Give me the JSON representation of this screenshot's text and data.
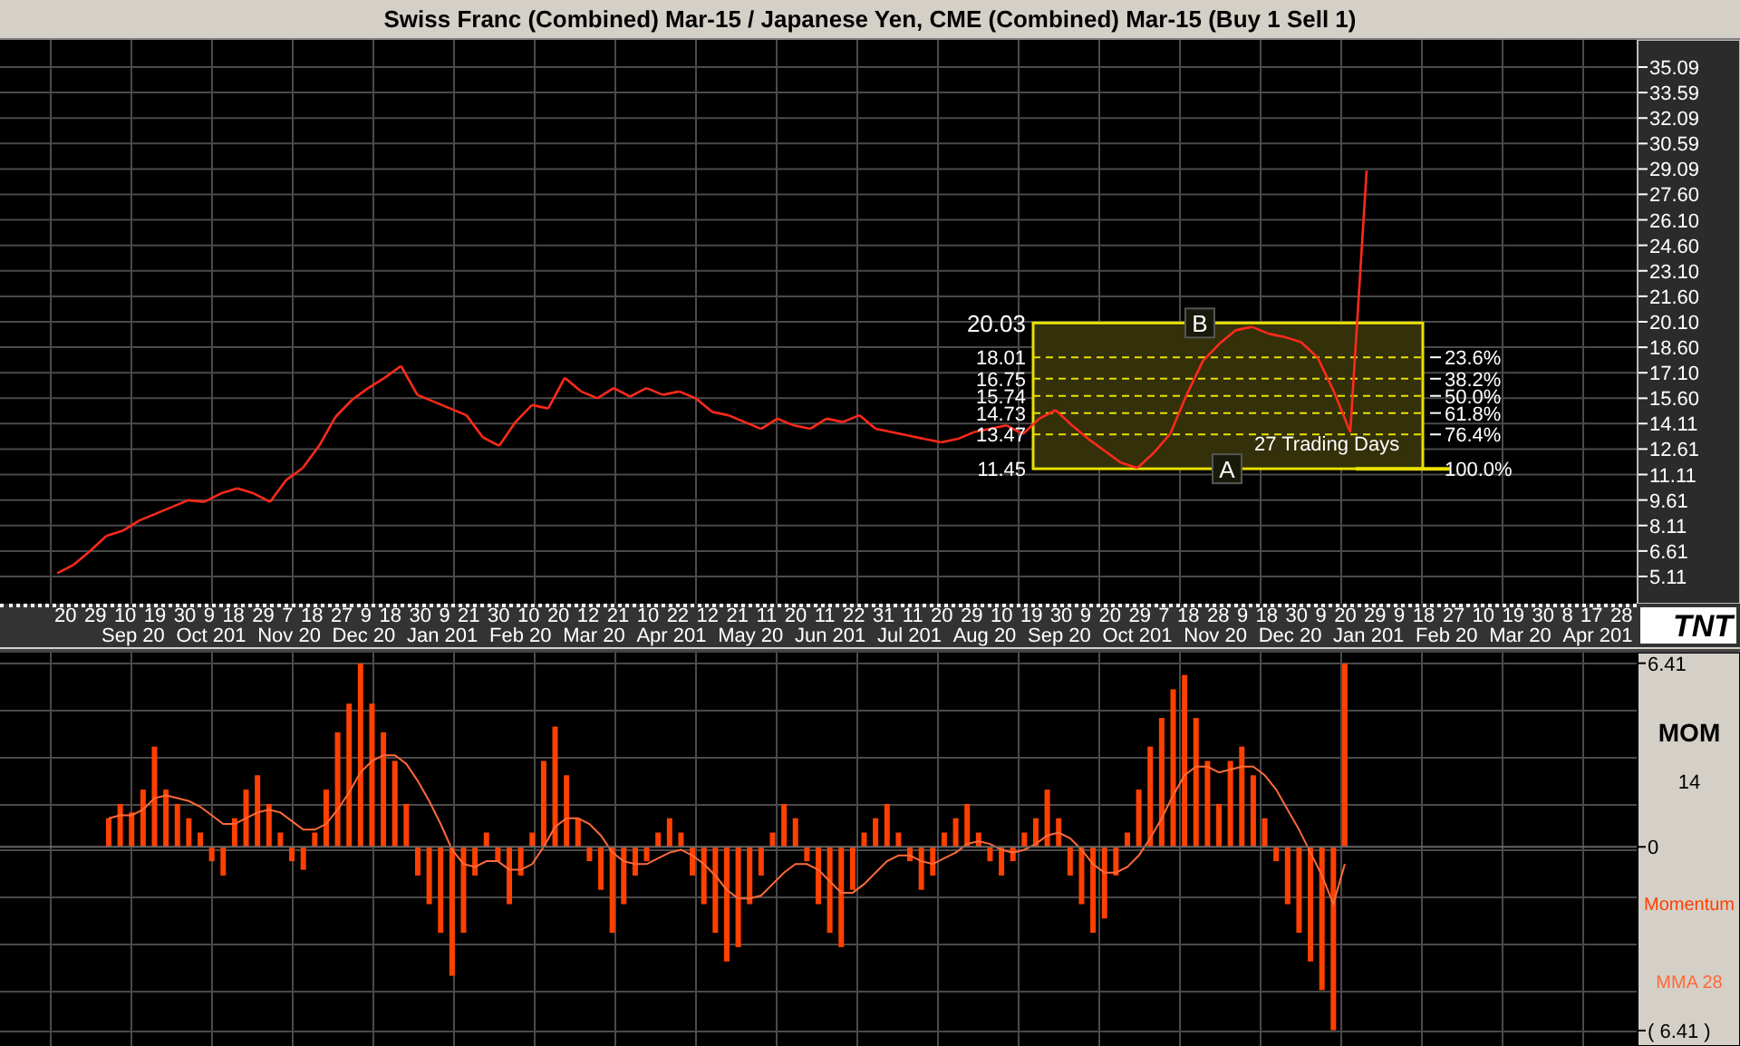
{
  "window": {
    "title": "Swiss Franc (Combined) Mar-15  / Japanese Yen, CME (Combined) Mar-15 (Buy 1 Sell 1)"
  },
  "price_chart": {
    "chart_data": {
      "type": "line",
      "grid": true,
      "ylim": [
        3.51,
        36.69
      ],
      "yticks": [
        {
          "value": 35.09,
          "label": "35.09"
        },
        {
          "value": 33.59,
          "label": "33.59"
        },
        {
          "value": 32.09,
          "label": "32.09"
        },
        {
          "value": 30.59,
          "label": "30.59"
        },
        {
          "value": 29.09,
          "label": "29.09"
        },
        {
          "value": 27.6,
          "label": "27.60"
        },
        {
          "value": 26.1,
          "label": "26.10"
        },
        {
          "value": 24.6,
          "label": "24.60"
        },
        {
          "value": 23.1,
          "label": "23.10"
        },
        {
          "value": 21.6,
          "label": "21.60"
        },
        {
          "value": 20.1,
          "label": "20.10"
        },
        {
          "value": 18.6,
          "label": "18.60"
        },
        {
          "value": 17.1,
          "label": "17.10"
        },
        {
          "value": 15.6,
          "label": "15.60"
        },
        {
          "value": 14.11,
          "label": "14.11"
        },
        {
          "value": 12.61,
          "label": "12.61"
        },
        {
          "value": 11.11,
          "label": "11.11"
        },
        {
          "value": 9.61,
          "label": "9.61"
        },
        {
          "value": 8.11,
          "label": "8.11"
        },
        {
          "value": 6.61,
          "label": "6.61"
        },
        {
          "value": 5.11,
          "label": "5.11"
        }
      ],
      "categories": [
        null,
        null,
        null,
        null,
        null,
        null,
        null,
        null,
        null,
        null,
        null,
        null,
        null,
        null,
        null,
        null,
        null,
        null,
        null,
        null,
        null,
        null,
        null,
        null,
        null,
        null,
        null,
        null,
        null,
        null,
        null,
        null,
        null,
        null,
        null,
        null,
        null,
        null,
        null,
        null,
        null,
        null,
        null,
        null,
        null,
        null,
        null,
        null,
        null,
        null,
        null,
        null,
        null,
        null,
        null,
        null,
        null,
        null,
        null,
        null,
        null,
        null,
        null,
        null,
        null,
        null,
        null,
        null,
        null,
        null,
        null,
        null,
        null,
        null,
        null,
        null,
        null,
        null,
        null,
        null,
        null,
        null,
        null,
        null,
        null,
        null,
        null,
        null,
        null,
        null,
        null,
        null,
        null,
        null,
        null,
        null,
        null,
        null,
        null,
        null
      ],
      "series": [
        {
          "color": "#ff2a1a",
          "values": [
            null,
            null,
            null,
            5.3,
            5.8,
            6.6,
            7.5,
            7.8,
            8.4,
            8.8,
            9.2,
            9.6,
            9.5,
            10.0,
            10.3,
            10.0,
            9.5,
            10.8,
            11.5,
            12.8,
            14.5,
            15.5,
            16.2,
            16.8,
            17.5,
            15.8,
            15.4,
            15.0,
            14.6,
            13.3,
            12.8,
            14.2,
            15.2,
            15.0,
            16.8,
            16.0,
            15.6,
            16.2,
            15.7,
            16.2,
            15.8,
            16.0,
            15.6,
            14.8,
            14.6,
            14.2,
            13.8,
            14.4,
            14.0,
            13.8,
            14.4,
            14.2,
            14.6,
            13.8,
            13.6,
            13.4,
            13.2,
            13.0,
            13.2,
            13.6,
            13.8,
            14.0,
            13.5,
            14.4,
            14.9,
            14.0,
            13.2,
            12.5,
            11.8,
            11.5,
            12.4,
            13.5,
            15.8,
            17.8,
            18.8,
            19.6,
            19.8,
            19.4,
            19.2,
            18.9,
            18.0,
            16.0,
            13.6,
            29.0,
            null,
            null,
            null,
            null,
            null,
            null,
            null,
            null,
            null,
            null,
            null,
            null,
            null,
            null,
            null,
            null
          ]
        }
      ]
    },
    "fibonacci": {
      "top_price": "20.03",
      "high_label": "B",
      "low_label": "A",
      "levels": [
        {
          "price": "18.01",
          "percent": "23.6%"
        },
        {
          "price": "16.75",
          "percent": "38.2%"
        },
        {
          "price": "15.74",
          "percent": "50.0%"
        },
        {
          "price": "14.73",
          "percent": "61.8%"
        },
        {
          "price": "13.47",
          "percent": "76.4%"
        },
        {
          "price": "11.45",
          "percent": "100.0%"
        }
      ],
      "duration": "27 Trading Days"
    }
  },
  "date_axis": {
    "days": [
      "20",
      "29",
      "10",
      "19",
      "30",
      "9",
      "18",
      "29",
      "7",
      "18",
      "27",
      "9",
      "18",
      "30",
      "9",
      "21",
      "30",
      "10",
      "20",
      "12",
      "21",
      "10",
      "22",
      "12",
      "21",
      "11",
      "20",
      "11",
      "22",
      "31",
      "11",
      "20",
      "29",
      "10",
      "19",
      "30",
      "9",
      "20",
      "29",
      "7",
      "18",
      "28",
      "9",
      "18",
      "30",
      "9",
      "20",
      "29",
      "9",
      "18",
      "27",
      "10",
      "19",
      "30",
      "8",
      "17",
      "28"
    ],
    "months": [
      "Sep 20",
      "Oct 201",
      "Nov 20",
      "Dec 20",
      "Jan 201",
      "Feb 20",
      "Mar 20",
      "Apr 201",
      "May 20",
      "Jun 201",
      "Jul 201",
      "Aug 20",
      "Sep 20",
      "Oct 201",
      "Nov 20",
      "Dec 20",
      "Jan 201",
      "Feb 20",
      "Mar 20",
      "Apr 201"
    ]
  },
  "logo": "TNT",
  "momentum_panel": {
    "title": "MOM",
    "period": "14",
    "chart_data": {
      "type": "bar",
      "grid": true,
      "ylim": [
        -6.95,
        6.78
      ],
      "yticks": [
        {
          "value": 6.41,
          "label": "6.41"
        },
        {
          "value": 0,
          "label": "0"
        },
        {
          "value": -6.41,
          "label": "( 6.41 )"
        }
      ],
      "categories": [
        null,
        null,
        null,
        null,
        null,
        null,
        null,
        null,
        null,
        null,
        null,
        null,
        null,
        null,
        null,
        null,
        null,
        null,
        null,
        null,
        null,
        null,
        null,
        null,
        null,
        null,
        null,
        null,
        null,
        null,
        null,
        null,
        null,
        null,
        null,
        null,
        null,
        null,
        null,
        null,
        null,
        null,
        null,
        null,
        null,
        null,
        null,
        null,
        null,
        null,
        null,
        null,
        null,
        null,
        null,
        null,
        null,
        null,
        null,
        null,
        null,
        null,
        null,
        null,
        null,
        null,
        null,
        null,
        null,
        null,
        null,
        null,
        null,
        null,
        null,
        null,
        null,
        null,
        null,
        null,
        null,
        null,
        null,
        null,
        null,
        null,
        null,
        null,
        null,
        null,
        null,
        null,
        null,
        null,
        null,
        null,
        null,
        null,
        null,
        null,
        null,
        null,
        null,
        null,
        null,
        null,
        null,
        null,
        null,
        null,
        null,
        null,
        null,
        null,
        null,
        null,
        null,
        null,
        null,
        null,
        null,
        null,
        null,
        null,
        null,
        null,
        null,
        null,
        null,
        null,
        null,
        null,
        null,
        null,
        null,
        null,
        null,
        null,
        null,
        null,
        null,
        null,
        null
      ],
      "series": [
        {
          "name": "Momentum",
          "color": "#ff4000",
          "values": [
            null,
            null,
            null,
            null,
            null,
            null,
            null,
            null,
            null,
            1,
            1.5,
            1.2,
            2,
            3.5,
            2,
            1.5,
            1,
            0.5,
            -0.5,
            -1,
            1,
            2,
            2.5,
            1.5,
            0.5,
            -0.5,
            -0.8,
            0.5,
            2,
            4,
            5,
            6.4,
            5,
            4,
            3,
            1.5,
            -1,
            -2,
            -3,
            -4.5,
            -3,
            -1,
            0.5,
            -0.5,
            -2,
            -1,
            0.5,
            3,
            4.2,
            2.5,
            1,
            -0.5,
            -1.5,
            -3,
            -2,
            -1,
            -0.5,
            0.5,
            1,
            0.5,
            -1,
            -2,
            -3,
            -4,
            -3.5,
            -2,
            -1,
            0.5,
            1.5,
            1,
            -0.5,
            -2,
            -3,
            -3.5,
            -1.5,
            0.5,
            1,
            1.5,
            0.5,
            -0.5,
            -1.5,
            -1,
            0.5,
            1,
            1.5,
            0.5,
            -0.5,
            -1,
            -0.5,
            0.5,
            1,
            2,
            1,
            -1,
            -2,
            -3,
            -2.5,
            -1,
            0.5,
            2,
            3.5,
            4.5,
            5.5,
            6,
            4.5,
            3,
            1.5,
            3,
            3.5,
            2.5,
            1,
            -0.5,
            -2,
            -3,
            -4,
            -5,
            -6.4,
            6.4,
            null,
            null,
            null,
            null,
            null,
            null,
            null,
            null,
            null,
            null,
            null,
            null,
            null,
            null,
            null,
            null,
            null,
            null,
            null,
            null,
            null,
            null,
            null,
            null,
            null
          ]
        },
        {
          "name": "MMA 28",
          "type": "line",
          "color": "#ff6a3a",
          "values": [
            null,
            null,
            null,
            null,
            null,
            null,
            null,
            null,
            null,
            1,
            1.1,
            1.1,
            1.3,
            1.7,
            1.8,
            1.7,
            1.6,
            1.4,
            1.1,
            0.8,
            0.8,
            1.0,
            1.2,
            1.3,
            1.2,
            0.9,
            0.6,
            0.6,
            0.8,
            1.3,
            1.9,
            2.6,
            3.0,
            3.2,
            3.2,
            2.9,
            2.3,
            1.6,
            0.8,
            -0.1,
            -0.6,
            -0.7,
            -0.5,
            -0.5,
            -0.8,
            -0.8,
            -0.6,
            0,
            0.7,
            1.0,
            1.0,
            0.8,
            0.4,
            -0.2,
            -0.5,
            -0.6,
            -0.6,
            -0.4,
            -0.2,
            -0.1,
            -0.3,
            -0.6,
            -1.0,
            -1.5,
            -1.8,
            -1.8,
            -1.7,
            -1.3,
            -0.9,
            -0.6,
            -0.6,
            -0.8,
            -1.2,
            -1.6,
            -1.6,
            -1.3,
            -0.9,
            -0.5,
            -0.3,
            -0.3,
            -0.5,
            -0.6,
            -0.4,
            -0.2,
            0.1,
            0.2,
            0.1,
            -0.1,
            -0.2,
            -0.1,
            0.1,
            0.4,
            0.5,
            0.3,
            -0.1,
            -0.6,
            -0.9,
            -0.9,
            -0.7,
            -0.3,
            0.3,
            1.0,
            1.8,
            2.5,
            2.8,
            2.8,
            2.6,
            2.7,
            2.8,
            2.8,
            2.5,
            2.0,
            1.3,
            0.6,
            -0.2,
            -1.0,
            -2.0,
            -0.6,
            null,
            null,
            null,
            null,
            null,
            null,
            null,
            null,
            null,
            null,
            null,
            null,
            null,
            null,
            null,
            null,
            null,
            null,
            null,
            null,
            null,
            null,
            null,
            null,
            null
          ]
        }
      ]
    }
  }
}
